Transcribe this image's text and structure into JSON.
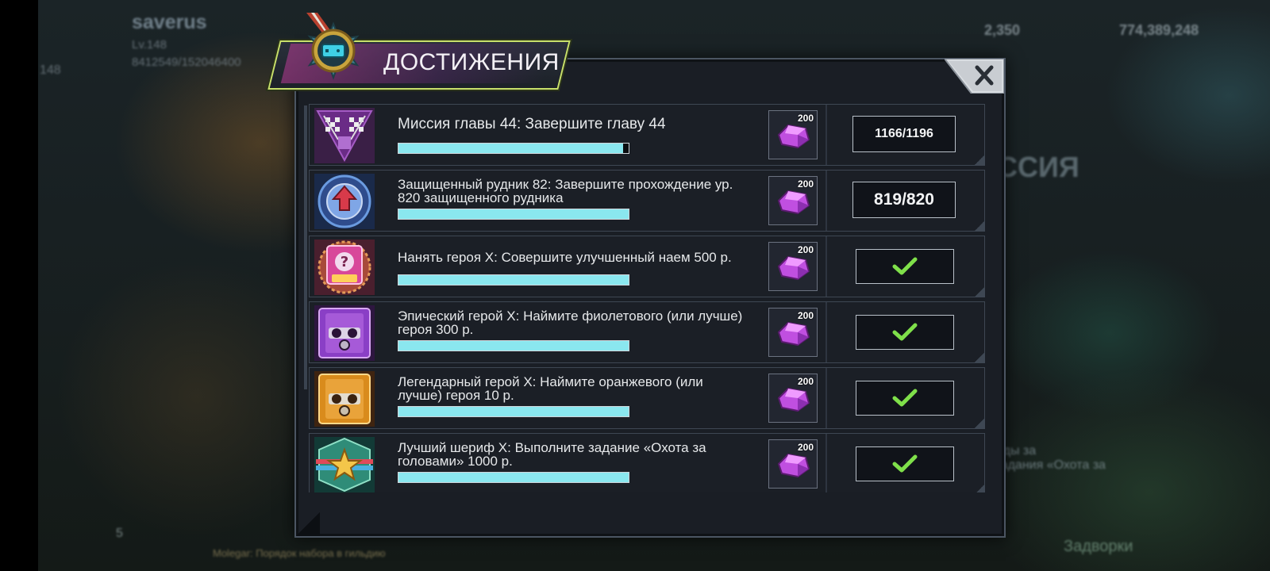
{
  "background": {
    "player_name": "saverus",
    "level_text": "Lv.148",
    "xp_text": "8412549/152046400",
    "level_badge": "148",
    "currency_1": "2,350",
    "currency_2": "774,389,248",
    "chat_preview": "Molegar: Порядок набора в гильдию",
    "right_panel_title": "ССИЯ",
    "right_panel_text": "грады за\nе задания «Охота за",
    "social_count": "5",
    "bottom_tab": "Задворки"
  },
  "dialog": {
    "title": "ДОСТИЖЕНИЯ",
    "close_icon": "close-x-icon",
    "achievements": [
      {
        "icon": "checkered-flags-icon",
        "description": "Миссия главы 44: Завершите главу 44",
        "progress": 0.975,
        "reward_icon": "purple-gem-icon",
        "reward_amount": "200",
        "status": "1166/1196",
        "completed": false
      },
      {
        "icon": "shield-mine-icon",
        "description": "Защищенный рудник 82: Завершите прохождение ур. 820 защищенного рудника",
        "progress": 0.999,
        "reward_icon": "purple-gem-icon",
        "reward_amount": "200",
        "status": "819/820",
        "completed": false
      },
      {
        "icon": "mystery-badge-icon",
        "description": "Нанять героя X: Совершите улучшенный наем 500 р.",
        "progress": 1.0,
        "reward_icon": "purple-gem-icon",
        "reward_amount": "200",
        "status": "",
        "completed": true
      },
      {
        "icon": "purple-gasmask-icon",
        "description": "Эпический герой X: Наймите фиолетового (или лучше) героя 300 р.",
        "progress": 1.0,
        "reward_icon": "purple-gem-icon",
        "reward_amount": "200",
        "status": "",
        "completed": true
      },
      {
        "icon": "orange-gasmask-icon",
        "description": "Легендарный герой X: Наймите оранжевого (или лучше) героя 10 р.",
        "progress": 1.0,
        "reward_icon": "purple-gem-icon",
        "reward_amount": "200",
        "status": "",
        "completed": true
      },
      {
        "icon": "sheriff-star-icon",
        "description": "Лучший шериф X: Выполните задание «Охота за головами» 1000 р.",
        "progress": 1.0,
        "reward_icon": "purple-gem-icon",
        "reward_amount": "200",
        "status": "",
        "completed": true
      }
    ]
  },
  "colors": {
    "progress_fill": "#8ae7ef",
    "check_green": "#7fe04a",
    "title_border": "#c8e06a",
    "gem_purple": "#c04fe0"
  }
}
